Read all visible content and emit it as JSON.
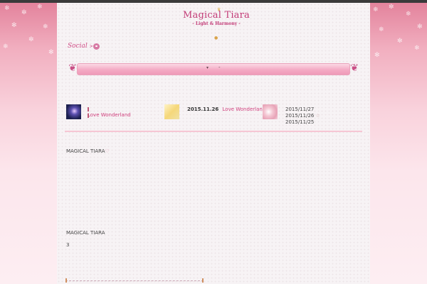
{
  "site": {
    "logo_title": "Magical Tiara",
    "logo_subtitle": "- Light & Harmony -"
  },
  "header": {
    "social_label": "Social",
    "social_arrows": ">>"
  },
  "nav": {
    "dropdown_symbol": "▾",
    "separator": "-"
  },
  "posts": [
    {
      "link": "Love Wonderland",
      "date": ""
    },
    {
      "date": "2015.11.26",
      "link": "Love Wonderland"
    },
    {
      "dates": [
        "2015/11/27",
        "2015/11/26",
        "2015/11/25"
      ]
    }
  ],
  "content": {
    "para1": "MAGICAL TIARA",
    "para1_heart": "♡",
    "para2": "MAGICAL TIARA",
    "para3": "3"
  },
  "icons": {
    "twitter": "twitter-icon",
    "star": "☆"
  },
  "colors": {
    "accent": "#d0417d",
    "nav_band": "#f4aac4",
    "divider": "#f6c6d4"
  }
}
